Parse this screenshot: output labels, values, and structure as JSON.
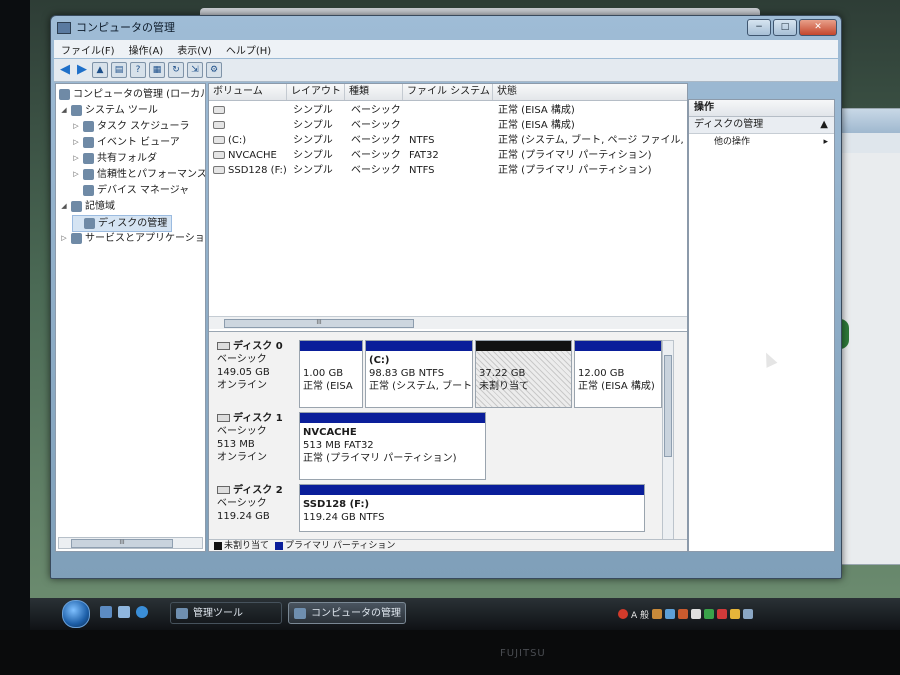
{
  "window": {
    "title": "コンピュータの管理",
    "min_glyph": "−",
    "max_glyph": "□",
    "close_glyph": "✕"
  },
  "menu": [
    "ファイル(F)",
    "操作(A)",
    "表示(V)",
    "ヘルプ(H)"
  ],
  "toolbar_icons": [
    "back-arrow-icon",
    "forward-arrow-icon",
    "up-folder-icon",
    "console-tree-icon",
    "help-icon",
    "properties-icon",
    "refresh-icon",
    "export-icon",
    "settings-icon"
  ],
  "tree": {
    "root": "コンピュータの管理 (ローカル)",
    "items": [
      {
        "label": "システム ツール",
        "level": 1,
        "expand": "◢"
      },
      {
        "label": "タスク スケジューラ",
        "level": 2,
        "expand": "▷"
      },
      {
        "label": "イベント ビューア",
        "level": 2,
        "expand": "▷"
      },
      {
        "label": "共有フォルダ",
        "level": 2,
        "expand": "▷"
      },
      {
        "label": "信頼性とパフォーマンス",
        "level": 2,
        "expand": "▷"
      },
      {
        "label": "デバイス マネージャ",
        "level": 2,
        "expand": ""
      },
      {
        "label": "記憶域",
        "level": 1,
        "expand": "◢"
      },
      {
        "label": "ディスクの管理",
        "level": 2,
        "expand": "",
        "selected": true
      },
      {
        "label": "サービスとアプリケーション",
        "level": 1,
        "expand": "▷"
      }
    ],
    "scroll_glyph": "III"
  },
  "volumes": {
    "headers": [
      "ボリューム",
      "レイアウト",
      "種類",
      "ファイル システム",
      "状態"
    ],
    "rows": [
      {
        "vol": "",
        "layout": "シンプル",
        "type": "ベーシック",
        "fs": "",
        "status": "正常 (EISA 構成)"
      },
      {
        "vol": "",
        "layout": "シンプル",
        "type": "ベーシック",
        "fs": "",
        "status": "正常 (EISA 構成)"
      },
      {
        "vol": "(C:)",
        "layout": "シンプル",
        "type": "ベーシック",
        "fs": "NTFS",
        "status": "正常 (システム, ブート, ページ ファイル, ア"
      },
      {
        "vol": "NVCACHE",
        "layout": "シンプル",
        "type": "ベーシック",
        "fs": "FAT32",
        "status": "正常 (プライマリ パーティション)"
      },
      {
        "vol": "SSD128 (F:)",
        "layout": "シンプル",
        "type": "ベーシック",
        "fs": "NTFS",
        "status": "正常 (プライマリ パーティション)"
      }
    ],
    "scroll_glyph": "III"
  },
  "disks": [
    {
      "name": "ディスク 0",
      "kind": "ベーシック",
      "size": "149.05 GB",
      "state": "オンライン",
      "partitions": [
        {
          "title": "",
          "line1": "1.00 GB",
          "line2": "正常 (EISA",
          "color": "#0a1e9a"
        },
        {
          "title": "(C:)",
          "line1": "98.83 GB NTFS",
          "line2": "正常 (システム, ブート",
          "color": "#0a1e9a"
        },
        {
          "title": "",
          "line1": "37.22 GB",
          "line2": "未割り当て",
          "color": "#111111",
          "unallocated": true
        },
        {
          "title": "",
          "line1": "12.00 GB",
          "line2": "正常 (EISA 構成)",
          "color": "#0a1e9a"
        }
      ]
    },
    {
      "name": "ディスク 1",
      "kind": "ベーシック",
      "size": "513 MB",
      "state": "オンライン",
      "partitions": [
        {
          "title": "NVCACHE",
          "line1": "513 MB FAT32",
          "line2": "正常 (プライマリ パーティション)",
          "color": "#0a1e9a"
        }
      ]
    },
    {
      "name": "ディスク 2",
      "kind": "ベーシック",
      "size": "119.24 GB",
      "state": "",
      "partitions": [
        {
          "title": "SSD128  (F:)",
          "line1": "119.24 GB NTFS",
          "line2": "",
          "color": "#0a1e9a"
        }
      ]
    }
  ],
  "legend": [
    {
      "label": "未割り当て",
      "color": "#111111"
    },
    {
      "label": "プライマリ パーティション",
      "color": "#0a1e9a"
    }
  ],
  "actions": {
    "header": "操作",
    "section": "ディスクの管理",
    "section_glyph": "▲",
    "item": "他の操作",
    "item_glyph": "▸"
  },
  "taskbar": {
    "buttons": [
      "管理ツール",
      "コンピュータの管理"
    ],
    "tray_text": "A 般"
  },
  "monitor_brand": "FUJITSU"
}
